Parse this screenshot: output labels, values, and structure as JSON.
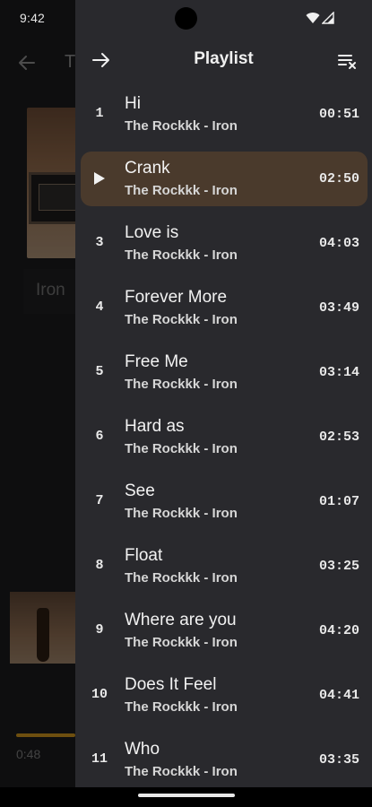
{
  "status_bar": {
    "time": "9:42",
    "icons": [
      "wifi-icon",
      "cellular-signal-icon"
    ]
  },
  "background_player": {
    "title_fragment": "T",
    "album_name": "Iron",
    "elapsed": "0:48",
    "progress_color": "#c8901c"
  },
  "playlist": {
    "title": "Playlist",
    "accent_bg": "#4a3a2c",
    "tracks": [
      {
        "number": "1",
        "title": "Hi",
        "subtitle": "The Rockkk - Iron",
        "duration": "00:51",
        "active": false
      },
      {
        "number": "2",
        "title": "Crank",
        "subtitle": "The Rockkk - Iron",
        "duration": "02:50",
        "active": true
      },
      {
        "number": "3",
        "title": "Love is",
        "subtitle": "The Rockkk - Iron",
        "duration": "04:03",
        "active": false
      },
      {
        "number": "4",
        "title": "Forever More",
        "subtitle": "The Rockkk - Iron",
        "duration": "03:49",
        "active": false
      },
      {
        "number": "5",
        "title": "Free Me",
        "subtitle": "The Rockkk - Iron",
        "duration": "03:14",
        "active": false
      },
      {
        "number": "6",
        "title": "Hard as",
        "subtitle": "The Rockkk - Iron",
        "duration": "02:53",
        "active": false
      },
      {
        "number": "7",
        "title": "See",
        "subtitle": "The Rockkk - Iron",
        "duration": "01:07",
        "active": false
      },
      {
        "number": "8",
        "title": "Float",
        "subtitle": "The Rockkk - Iron",
        "duration": "03:25",
        "active": false
      },
      {
        "number": "9",
        "title": "Where are you",
        "subtitle": "The Rockkk - Iron",
        "duration": "04:20",
        "active": false
      },
      {
        "number": "10",
        "title": "Does It Feel",
        "subtitle": "The Rockkk - Iron",
        "duration": "04:41",
        "active": false
      },
      {
        "number": "11",
        "title": "Who",
        "subtitle": "The Rockkk - Iron",
        "duration": "03:35",
        "active": false
      }
    ]
  }
}
